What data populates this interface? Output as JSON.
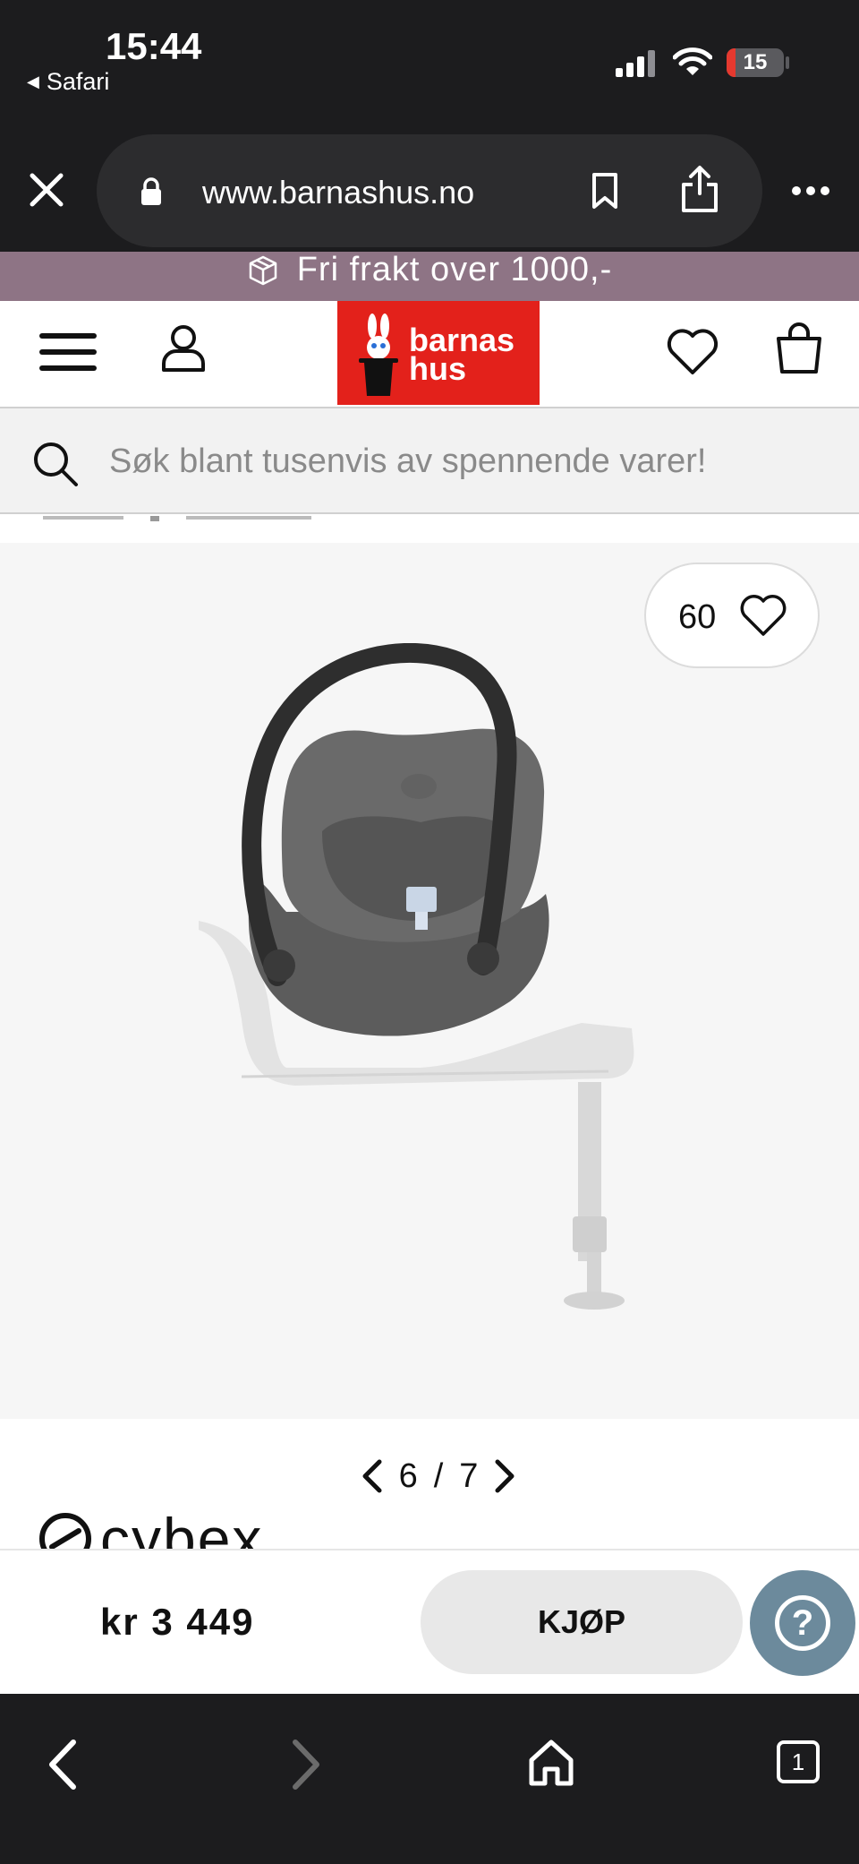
{
  "status": {
    "time": "15:44",
    "back_app": "Safari",
    "battery": "15"
  },
  "browser": {
    "url": "www.barnashus.no"
  },
  "banner": {
    "text": "Fri frakt over 1000,-"
  },
  "logo": {
    "line1": "barnas",
    "line2": "hus",
    "color": "#e3211b"
  },
  "search": {
    "placeholder": "Søk blant tusenvis av spennende varer!"
  },
  "product": {
    "likes": "60",
    "pager_current": "6",
    "pager_separator": "/",
    "pager_total": "7",
    "brand": "cybex",
    "price": "kr 3 449",
    "buy_label": "KJØP"
  },
  "help": {
    "label": "?",
    "color": "#6c8a9c"
  }
}
